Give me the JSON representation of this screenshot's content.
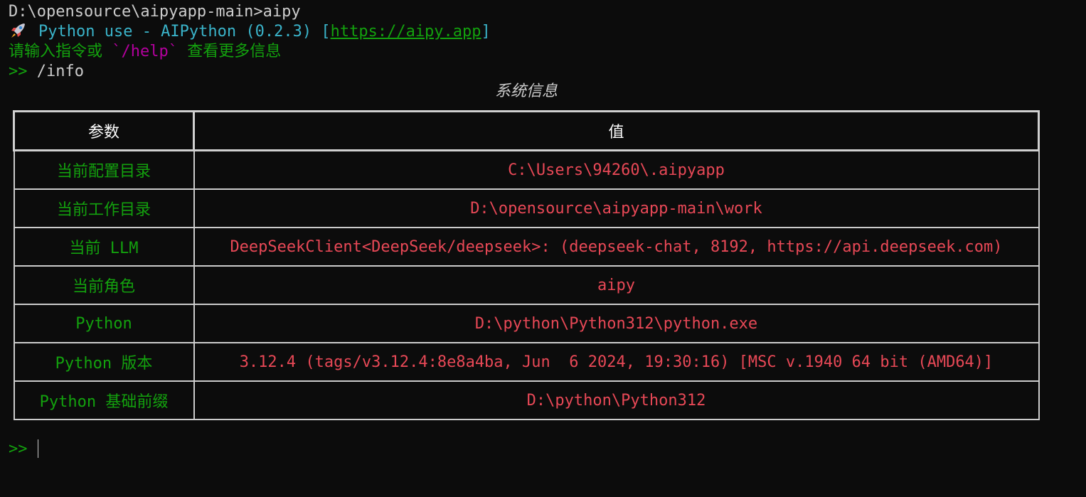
{
  "terminal": {
    "line1": "D:\\opensource\\aipyapp-main>aipy",
    "banner": {
      "icon": "rocket-icon",
      "app": "Python use - AIPython (0.2.3) ",
      "bracket_open": "[",
      "url": "https://aipy.app",
      "bracket_close": "]"
    },
    "hint": {
      "before": "请输入指令或 ",
      "command": "`/help`",
      "after": " 查看更多信息"
    },
    "prompt": ">> ",
    "command": "/info",
    "final_prompt": ">>"
  },
  "table": {
    "title": "系统信息",
    "headers": [
      "参数",
      "值"
    ],
    "rows": [
      {
        "param": "当前配置目录",
        "value": "C:\\Users\\94260\\.aipyapp"
      },
      {
        "param": "当前工作目录",
        "value": "D:\\opensource\\aipyapp-main\\work"
      },
      {
        "param": "当前 LLM",
        "value": "DeepSeekClient<DeepSeek/deepseek>: (deepseek-chat, 8192, https://api.deepseek.com)"
      },
      {
        "param": "当前角色",
        "value": "aipy"
      },
      {
        "param": "Python",
        "value": "D:\\python\\Python312\\python.exe"
      },
      {
        "param": "Python 版本",
        "value": "3.12.4 (tags/v3.12.4:8e8a4ba, Jun  6 2024, 19:30:16) [MSC v.1940 64 bit (AMD64)]"
      },
      {
        "param": "Python 基础前缀",
        "value": "D:\\python\\Python312"
      }
    ]
  },
  "colors": {
    "background": "#0c0c0c",
    "text": "#cccccc",
    "green": "#13a10e",
    "red": "#e74856",
    "cyan": "#3ab3c9",
    "magenta": "#b4009e"
  }
}
